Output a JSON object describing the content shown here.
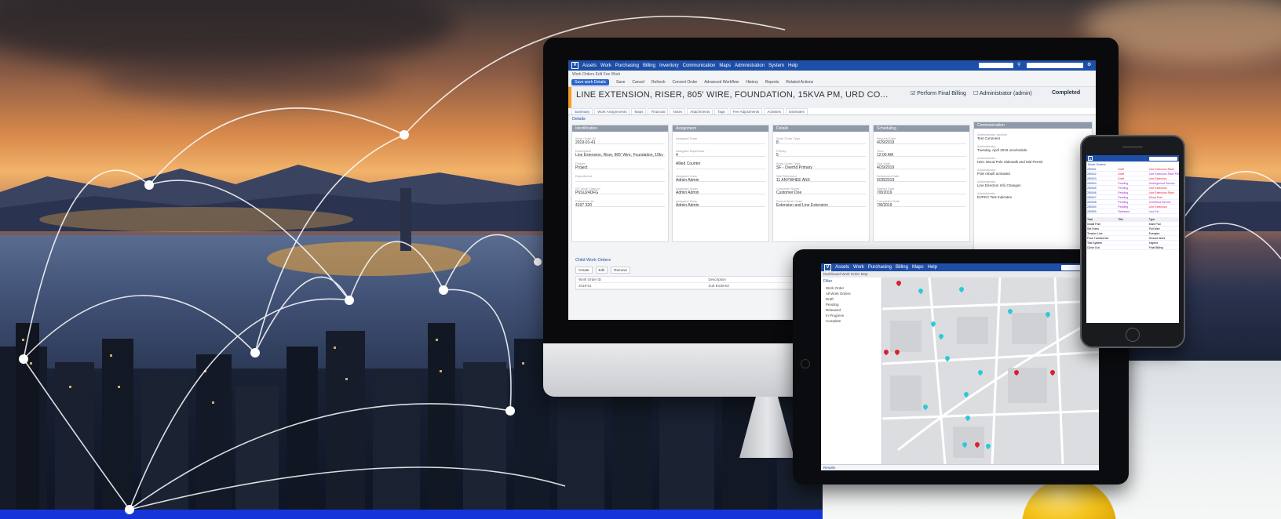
{
  "app": {
    "nav_items": [
      "Assets",
      "Work",
      "Purchasing",
      "Billing",
      "Inventory",
      "Communication",
      "Maps",
      "Administration",
      "System",
      "Help"
    ],
    "breadcrumb": "Work Orders  Edit Fee Work",
    "toolbar": [
      "Save work Details",
      "Save",
      "Cancel",
      "Refresh",
      "Convert Order",
      "Advanced Workflow",
      "History",
      "Reports",
      "Related Actions"
    ]
  },
  "record": {
    "title": "LINE EXTENSION, RISER, 805' WIRE, FOUNDATION, 15KVA PM, URD CO...",
    "final_billing_label": "Perform Final Billing",
    "assigned_label": "Administrator (admin)",
    "status": "Completed",
    "tabs": [
      "Summary",
      "Work Assignments",
      "Maps",
      "Financial",
      "Notes",
      "Attachments",
      "Tags",
      "Fee Adjustments",
      "Activities",
      "Estimates"
    ],
    "details_header": "Details"
  },
  "panels": [
    {
      "title": "Identification",
      "fields": [
        {
          "label": "Work Order ID",
          "value": "2019-01-41"
        },
        {
          "label": "Description",
          "value": "Line Extension, Riser, 805' Wire, Foundation, 15kv"
        },
        {
          "label": "Project",
          "value": "Project"
        },
        {
          "label": "Department",
          "value": ""
        },
        {
          "label": "GF Work Class Id",
          "value": "P6SU24DFG"
        },
        {
          "label": "Reference Id",
          "value": "4197 320"
        }
      ]
    },
    {
      "title": "Assignment",
      "fields": [
        {
          "label": "Assigned Team",
          "value": ""
        },
        {
          "label": "Assigned Supervisor",
          "value": "4"
        },
        {
          "label": "",
          "value": "Allied Counter"
        },
        {
          "label": "Assigned Crew",
          "value": "Admin Admin"
        },
        {
          "label": "Assigned Super",
          "value": "Admin Admin"
        },
        {
          "label": "Assigned Parts",
          "value": "Admin Admin"
        }
      ]
    },
    {
      "title": "Details",
      "fields": [
        {
          "label": "Work Order Type",
          "value": "8"
        },
        {
          "label": "Priority",
          "value": "5"
        },
        {
          "label": "Work Order Type",
          "value": "SF - Overhd Primary"
        },
        {
          "label": "Site Reference",
          "value": "11 ANYWHEE ANX"
        },
        {
          "label": "Customer Name",
          "value": "Customer Doe"
        },
        {
          "label": "Parent Work Order",
          "value": "Extension and Line Extension"
        }
      ]
    },
    {
      "title": "Scheduling",
      "fields": [
        {
          "label": "Request Date",
          "value": "4/29/2019"
        },
        {
          "label": "Time",
          "value": "12:00 AM"
        },
        {
          "label": "Due Date",
          "value": "4/29/2019"
        },
        {
          "label": "Scheduled Date",
          "value": "5/28/2019"
        },
        {
          "label": "Started Date",
          "value": "7/8/2019"
        },
        {
          "label": "Completed Date",
          "value": "7/8/2019"
        }
      ]
    }
  ],
  "communication": {
    "header": "Communication",
    "entries": [
      {
        "author": "Administrator (admin)",
        "text": "Test Comment"
      },
      {
        "author": "Administrator",
        "text": "Tuesday, April 2019 unschedule"
      },
      {
        "author": "Administrator",
        "text": "NSC Wood Pole Sidewalk and Mid Permit"
      },
      {
        "author": "Administrator",
        "text": "Pole rebuilt activated"
      },
      {
        "author": "Administrator",
        "text": "Line Direction Info Changes"
      },
      {
        "author": "Administrator",
        "text": "EVPKC Test Indicates"
      }
    ]
  },
  "child": {
    "header": "Child Work Orders",
    "buttons": [
      "Create",
      "Edit",
      "Remove"
    ],
    "columns": [
      "Work Order ID",
      "Description",
      "Status"
    ],
    "row": [
      "2019-01",
      "Sub Endered",
      "Ordered Work Order"
    ]
  },
  "tablet": {
    "breadcrumb": "Dashboard  Work Order Map",
    "sidebar_title": "Filter",
    "filters": [
      "Work Order",
      "All Work Orders",
      "Draft",
      "Pending",
      "Released",
      "In Progress",
      "Complete"
    ],
    "footer": "Results"
  },
  "phone": {
    "header": "Work Orders",
    "rows": [
      {
        "id": "280541",
        "status": "Draft",
        "desc": "Line Extension Riser"
      },
      {
        "id": "280542",
        "status": "Draft",
        "desc": "Line Extension Riser PM"
      },
      {
        "id": "280543",
        "status": "Draft",
        "desc": "Line Extension"
      },
      {
        "id": "280544",
        "status": "Pending",
        "desc": "Underground Service"
      },
      {
        "id": "280545",
        "status": "Pending",
        "desc": "Line Extension"
      },
      {
        "id": "280546",
        "status": "Pending",
        "desc": "Line Extension Riser"
      },
      {
        "id": "280547",
        "status": "Pending",
        "desc": "Wood Pole"
      },
      {
        "id": "280548",
        "status": "Pending",
        "desc": "Overhead Service"
      },
      {
        "id": "280549",
        "status": "Pending",
        "desc": "Line Extension"
      },
      {
        "id": "280550",
        "status": "Released",
        "desc": "Line Ext"
      }
    ],
    "table_headers": [
      "Task",
      "Title",
      "Type"
    ],
    "tasks": [
      "Install Pole",
      "Mark Pad",
      "Set Poles",
      "Pull Wire",
      "Tension Line",
      "Energize",
      "Fuse Transformer",
      "Ground Work",
      "Test System",
      "Inspect",
      "Close Out",
      "Final Billing"
    ]
  },
  "colors": {
    "app_bar": "#1e4fa8",
    "accent_orange": "#f0a020",
    "pin_teal": "#2ec9d6",
    "pin_red": "#d92030",
    "bottom_bar": "#1535d9"
  }
}
